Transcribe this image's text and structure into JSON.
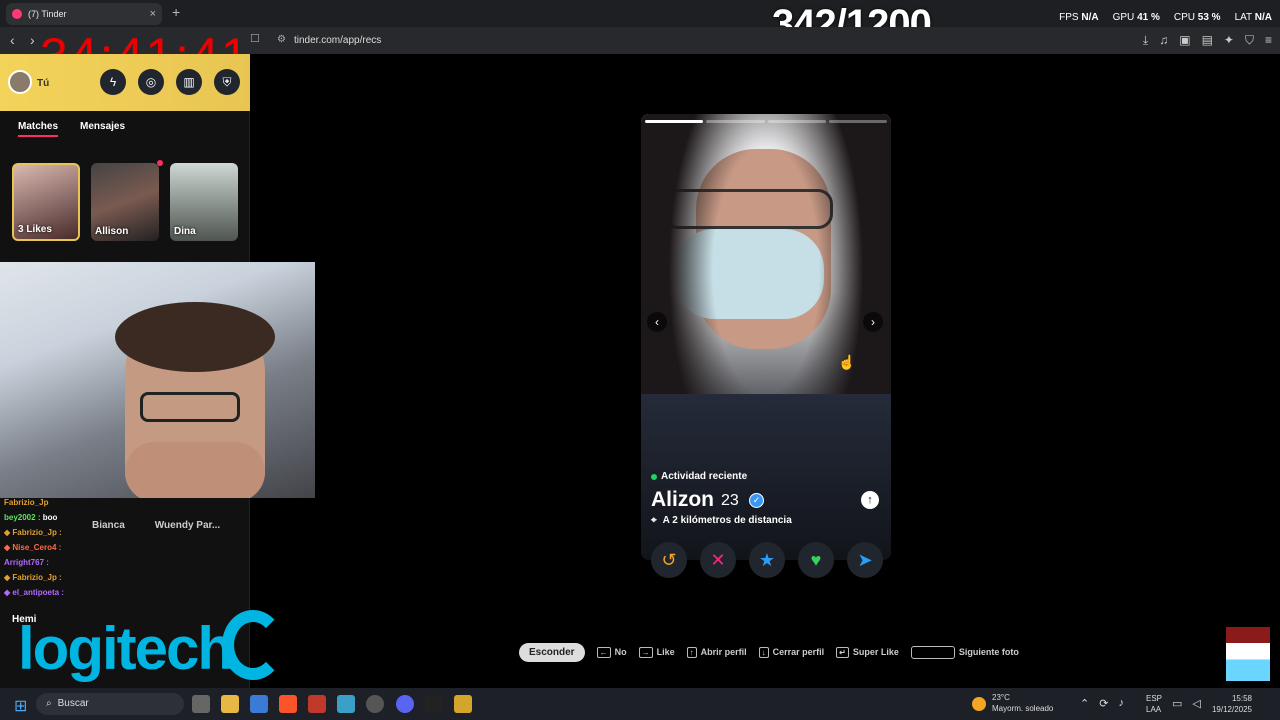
{
  "browser": {
    "tab_title": "(7) Tinder",
    "url": "tinder.com/app/recs"
  },
  "overlay": {
    "counter": "342/1200",
    "timer": "34:41:41",
    "stats": [
      {
        "label": "FPS",
        "value": "N/A"
      },
      {
        "label": "GPU",
        "value": "41 %"
      },
      {
        "label": "CPU",
        "value": "53 %"
      },
      {
        "label": "LAT",
        "value": "N/A"
      }
    ]
  },
  "sidebar": {
    "user_label": "Tú",
    "tabs": [
      "Matches",
      "Mensajes"
    ],
    "matches": [
      {
        "label": "3 Likes"
      },
      {
        "label": "Allison"
      },
      {
        "label": "Dina"
      }
    ],
    "lower_names": [
      "Bianca",
      "Wuendy Par..."
    ]
  },
  "chat": [
    {
      "user": "Fabrizio_Jp",
      "msg": ""
    },
    {
      "user": "bey2002",
      "msg": "boo"
    },
    {
      "user": "Fabrizio_Jp",
      "msg": ""
    },
    {
      "user": "Nise_Cero4",
      "msg": ""
    },
    {
      "user": "Arright767",
      "msg": ""
    },
    {
      "user": "Fabrizio_Jp",
      "msg": ""
    },
    {
      "user": "el_antipoeta",
      "msg": ""
    }
  ],
  "stream": {
    "viewer_name": "Hemi",
    "sponsor": "logitech"
  },
  "profile": {
    "status": "Actividad reciente",
    "name": "Alizon",
    "age": "23",
    "distance": "A 2 kilómetros de distancia",
    "photo_count": 4,
    "current_photo": 1
  },
  "actions": [
    {
      "name": "rewind",
      "icon": "↺",
      "color": "#f5a623"
    },
    {
      "name": "nope",
      "icon": "✕",
      "color": "#fd267d"
    },
    {
      "name": "super-like",
      "icon": "★",
      "color": "#2a9df4"
    },
    {
      "name": "like",
      "icon": "♥",
      "color": "#3ad15c"
    },
    {
      "name": "boost",
      "icon": "➤",
      "color": "#2a9df4"
    }
  ],
  "hints": {
    "hide": "Esconder",
    "items": [
      {
        "key": "←",
        "label": "No"
      },
      {
        "key": "→",
        "label": "Like"
      },
      {
        "key": "↑",
        "label": "Abrir perfil"
      },
      {
        "key": "↓",
        "label": "Cerrar perfil"
      },
      {
        "key": "↵",
        "label": "Super Like"
      }
    ],
    "space_label": "Siguiente foto"
  },
  "taskbar": {
    "search_placeholder": "Buscar",
    "weather_temp": "23°C",
    "weather_desc": "Mayorm. soleado",
    "lang_top": "ESP",
    "lang_bottom": "LAA",
    "time": "15:58",
    "date": "19/12/2025"
  },
  "colors": {
    "brand": "#fd2e62",
    "overlay_timer": "#e00000",
    "logitech": "#00b5e2"
  }
}
